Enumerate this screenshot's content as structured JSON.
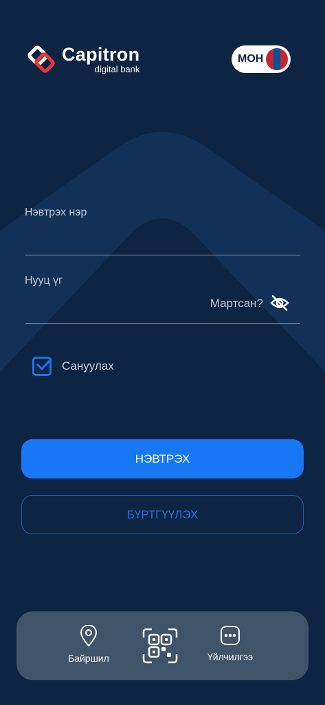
{
  "brand": {
    "name": "Capitron",
    "tagline": "digital bank"
  },
  "language": {
    "label": "МОН",
    "flag_colors": [
      "#c4272f",
      "#015197",
      "#c4272f"
    ]
  },
  "form": {
    "username_label": "Нэвтрэх нэр",
    "username_value": "",
    "password_label": "Нууц үг",
    "password_value": "",
    "forgot_label": "Мартсан?",
    "remember_label": "Сануулах",
    "remember_checked": true
  },
  "actions": {
    "login_label": "НЭВТРЭХ",
    "register_label": "БҮРТГҮҮЛЭХ"
  },
  "bottom_nav": {
    "location_label": "Байршил",
    "services_label": "Үйлчилгээ"
  },
  "colors": {
    "background": "#0d2442",
    "accent": "#1877f2",
    "bottom_bar": "#3f5369"
  }
}
